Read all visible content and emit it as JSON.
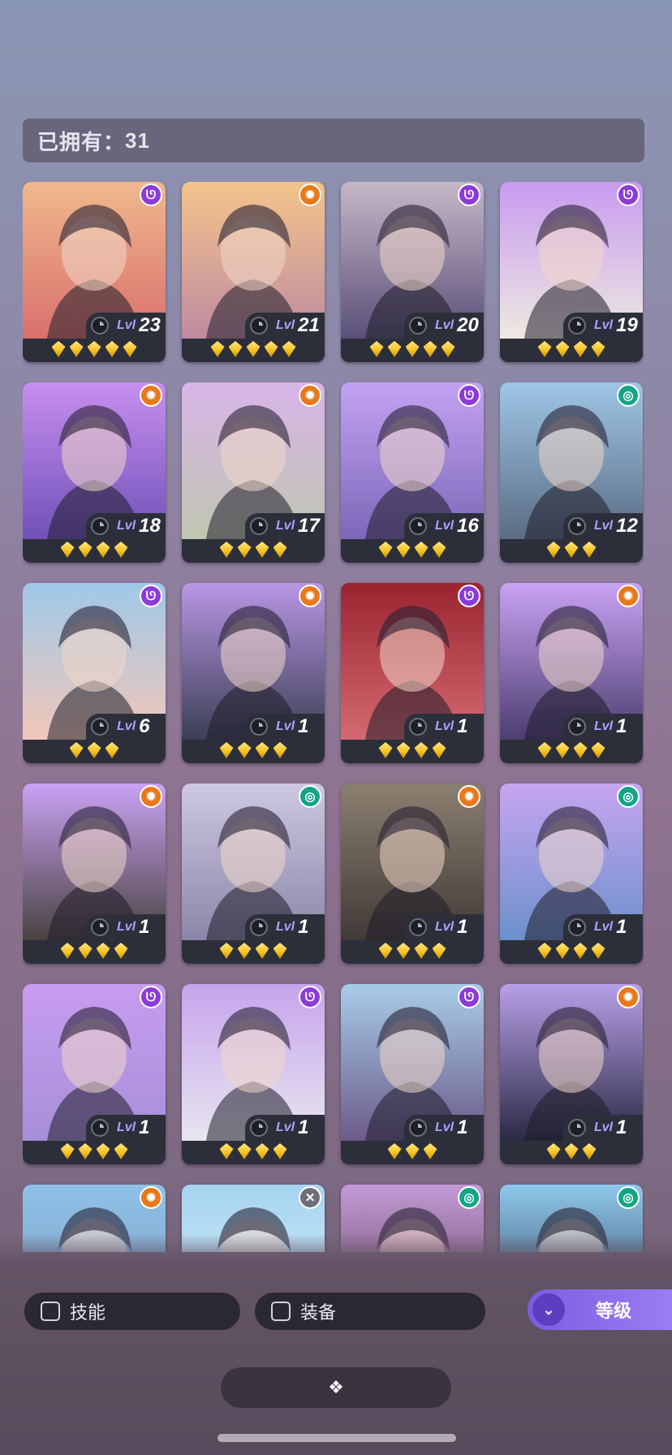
{
  "owned": {
    "label": "已拥有：",
    "count": "31"
  },
  "level_prefix": "Lvl",
  "heroes": [
    {
      "level": "23",
      "stars": 5,
      "faction": "purple",
      "faction_icon": "ᘎ",
      "bg": [
        "#f0b88d",
        "#d9706d"
      ]
    },
    {
      "level": "21",
      "stars": 5,
      "faction": "orange",
      "faction_icon": "✹",
      "bg": [
        "#f4c48b",
        "#bf8aa0"
      ]
    },
    {
      "level": "20",
      "stars": 5,
      "faction": "purple",
      "faction_icon": "ᘎ",
      "bg": [
        "#c6b8c8",
        "#5a4f78"
      ]
    },
    {
      "level": "19",
      "stars": 4,
      "faction": "purple",
      "faction_icon": "ᘎ",
      "bg": [
        "#c89af0",
        "#eee9e0"
      ]
    },
    {
      "level": "18",
      "stars": 4,
      "faction": "orange",
      "faction_icon": "✹",
      "bg": [
        "#c88ef0",
        "#6f52b8"
      ]
    },
    {
      "level": "17",
      "stars": 4,
      "faction": "orange",
      "faction_icon": "✹",
      "bg": [
        "#d8b4e8",
        "#bfc6b0"
      ]
    },
    {
      "level": "16",
      "stars": 4,
      "faction": "purple",
      "faction_icon": "ᘎ",
      "bg": [
        "#c3a2f4",
        "#7d67b8"
      ]
    },
    {
      "level": "12",
      "stars": 3,
      "faction": "teal",
      "faction_icon": "◎",
      "bg": [
        "#9fc6e6",
        "#5a6c84"
      ]
    },
    {
      "level": "6",
      "stars": 3,
      "faction": "purple",
      "faction_icon": "ᘎ",
      "bg": [
        "#9fc8e8",
        "#f1c7b9"
      ]
    },
    {
      "level": "1",
      "stars": 4,
      "faction": "orange",
      "faction_icon": "✹",
      "bg": [
        "#b996e4",
        "#3b3f55"
      ]
    },
    {
      "level": "1",
      "stars": 4,
      "faction": "purple",
      "faction_icon": "ᘎ",
      "bg": [
        "#9a2430",
        "#d36a72"
      ]
    },
    {
      "level": "1",
      "stars": 4,
      "faction": "orange",
      "faction_icon": "✹",
      "bg": [
        "#c9a2f4",
        "#4c3e70"
      ]
    },
    {
      "level": "1",
      "stars": 4,
      "faction": "orange",
      "faction_icon": "✹",
      "bg": [
        "#c9a2f4",
        "#4a4240"
      ]
    },
    {
      "level": "1",
      "stars": 4,
      "faction": "teal",
      "faction_icon": "◎",
      "bg": [
        "#cfc8e2",
        "#8b86a8"
      ]
    },
    {
      "level": "1",
      "stars": 4,
      "faction": "orange",
      "faction_icon": "✹",
      "bg": [
        "#8b7f70",
        "#403a36"
      ]
    },
    {
      "level": "1",
      "stars": 4,
      "faction": "teal",
      "faction_icon": "◎",
      "bg": [
        "#c6a6f0",
        "#6c8fcc"
      ]
    },
    {
      "level": "1",
      "stars": 4,
      "faction": "purple",
      "faction_icon": "ᘎ",
      "bg": [
        "#c89cf0",
        "#a68fd8"
      ]
    },
    {
      "level": "1",
      "stars": 4,
      "faction": "purple",
      "faction_icon": "ᘎ",
      "bg": [
        "#c6a4ec",
        "#e8e6f0"
      ]
    },
    {
      "level": "1",
      "stars": 3,
      "faction": "purple",
      "faction_icon": "ᘎ",
      "bg": [
        "#a8cce8",
        "#6b5a8a"
      ]
    },
    {
      "level": "1",
      "stars": 3,
      "faction": "orange",
      "faction_icon": "✹",
      "bg": [
        "#b8a0e8",
        "#2a2a44"
      ]
    },
    {
      "level": "",
      "stars": 0,
      "faction": "orange",
      "faction_icon": "✹",
      "bg": [
        "#8fc0e8",
        "#7aa0c0"
      ]
    },
    {
      "level": "",
      "stars": 0,
      "faction": "gray",
      "faction_icon": "✕",
      "bg": [
        "#a6d4f0",
        "#d8eef8"
      ]
    },
    {
      "level": "",
      "stars": 0,
      "faction": "teal",
      "faction_icon": "◎",
      "bg": [
        "#c29ad8",
        "#5a3a48"
      ]
    },
    {
      "level": "",
      "stars": 0,
      "faction": "teal",
      "faction_icon": "◎",
      "bg": [
        "#8ec8ec",
        "#2a3448"
      ]
    }
  ],
  "filters": {
    "skill": "技能",
    "equipment": "装备",
    "sort_level": "等级"
  },
  "collapse_icon": "❖"
}
